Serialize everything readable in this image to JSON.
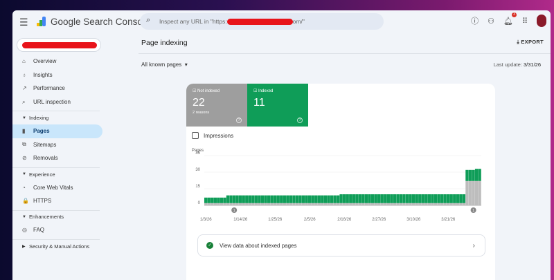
{
  "header": {
    "app_name": "Google Search Console",
    "search_placeholder_prefix": "Inspect any URL in \"https:",
    "search_placeholder_suffix": "om/\"",
    "notification_count": "3",
    "icons": [
      "menu-icon",
      "help-icon",
      "manage-users-icon",
      "bell-icon",
      "apps-grid-icon",
      "avatar"
    ]
  },
  "sidebar": {
    "top": [
      {
        "label": "Overview",
        "icon": "⌂"
      },
      {
        "label": "Insights",
        "icon": "♁"
      },
      {
        "label": "Performance",
        "icon": "↗"
      },
      {
        "label": "URL inspection",
        "icon": "⌕"
      }
    ],
    "indexing": {
      "label": "Indexing",
      "items": [
        {
          "label": "Pages",
          "icon": "▮"
        },
        {
          "label": "Sitemaps",
          "icon": "⧉"
        },
        {
          "label": "Removals",
          "icon": "⊘"
        }
      ]
    },
    "experience": {
      "label": "Experience",
      "items": [
        {
          "label": "Core Web Vitals",
          "icon": "◔"
        },
        {
          "label": "HTTPS",
          "icon": "🔒"
        }
      ]
    },
    "enhancements": {
      "label": "Enhancements",
      "items": [
        {
          "label": "FAQ",
          "icon": "◎"
        }
      ]
    },
    "security": {
      "label": "Security & Manual Actions"
    }
  },
  "main": {
    "title": "Page indexing",
    "export_label": "EXPORT",
    "filter_label": "All known pages",
    "last_update_label": "Last update:",
    "last_update_value": "3/31/26",
    "tiles": {
      "not_indexed": {
        "label": "Not indexed",
        "value": "22",
        "sub": "2 reasons",
        "color": "#9e9e9e"
      },
      "indexed": {
        "label": "Indexed",
        "value": "11",
        "color": "#0f9d58"
      }
    },
    "impressions_label": "Impressions",
    "cta_label": "View data about indexed pages"
  },
  "chart_data": {
    "type": "bar",
    "stacked": true,
    "ylabel": "Pages",
    "ylim": [
      0,
      45
    ],
    "yticks": [
      "0",
      "15",
      "30",
      "45"
    ],
    "xticks": [
      "1/3/26",
      "1/14/26",
      "1/25/26",
      "2/5/26",
      "2/16/26",
      "2/27/26",
      "3/10/26",
      "3/21/26"
    ],
    "annotations": [
      {
        "date": "1/12/26",
        "label": "1"
      },
      {
        "date": "3/29/26",
        "label": "1"
      }
    ],
    "x": [
      "1/3/26",
      "1/4/26",
      "1/5/26",
      "1/6/26",
      "1/7/26",
      "1/8/26",
      "1/9/26",
      "1/10/26",
      "1/11/26",
      "1/12/26",
      "1/13/26",
      "1/14/26",
      "1/15/26",
      "1/16/26",
      "1/17/26",
      "1/18/26",
      "1/19/26",
      "1/20/26",
      "1/21/26",
      "1/22/26",
      "1/23/26",
      "1/24/26",
      "1/25/26",
      "1/26/26",
      "1/27/26",
      "1/28/26",
      "1/29/26",
      "1/30/26",
      "1/31/26",
      "2/1/26",
      "2/2/26",
      "2/3/26",
      "2/4/26",
      "2/5/26",
      "2/6/26",
      "2/7/26",
      "2/8/26",
      "2/9/26",
      "2/10/26",
      "2/11/26",
      "2/12/26",
      "2/13/26",
      "2/14/26",
      "2/15/26",
      "2/16/26",
      "2/17/26",
      "2/18/26",
      "2/19/26",
      "2/20/26",
      "2/21/26",
      "2/22/26",
      "2/23/26",
      "2/24/26",
      "2/25/26",
      "2/26/26",
      "2/27/26",
      "2/28/26",
      "3/1/26",
      "3/2/26",
      "3/3/26",
      "3/4/26",
      "3/5/26",
      "3/6/26",
      "3/7/26",
      "3/8/26",
      "3/9/26",
      "3/10/26",
      "3/11/26",
      "3/12/26",
      "3/13/26",
      "3/14/26",
      "3/15/26",
      "3/16/26",
      "3/17/26",
      "3/18/26",
      "3/19/26",
      "3/20/26",
      "3/21/26",
      "3/22/26",
      "3/23/26",
      "3/24/26",
      "3/25/26",
      "3/26/26",
      "3/27/26",
      "3/28/26",
      "3/29/26",
      "3/30/26",
      "3/31/26"
    ],
    "series": [
      {
        "name": "Not indexed",
        "color": "#bdbdbd",
        "values": [
          2,
          2,
          2,
          2,
          2,
          2,
          2,
          2,
          2,
          2,
          2,
          2,
          2,
          2,
          2,
          2,
          2,
          2,
          2,
          2,
          2,
          2,
          2,
          2,
          2,
          2,
          2,
          2,
          2,
          2,
          2,
          2,
          2,
          2,
          2,
          2,
          2,
          2,
          2,
          2,
          2,
          2,
          2,
          2,
          2,
          2,
          2,
          2,
          2,
          2,
          2,
          2,
          2,
          2,
          2,
          2,
          2,
          2,
          2,
          2,
          2,
          2,
          2,
          2,
          2,
          2,
          2,
          2,
          2,
          2,
          2,
          2,
          2,
          2,
          2,
          2,
          2,
          2,
          2,
          2,
          2,
          2,
          2,
          22,
          22,
          22,
          22,
          22
        ]
      },
      {
        "name": "Indexed",
        "color": "#0f9d58",
        "values": [
          5,
          5,
          5,
          5,
          5,
          5,
          5,
          7,
          7,
          7,
          7,
          7,
          7,
          7,
          7,
          7,
          7,
          7,
          7,
          7,
          7,
          7,
          7,
          7,
          7,
          7,
          7,
          7,
          7,
          7,
          7,
          7,
          7,
          7,
          7,
          7,
          7,
          7,
          7,
          7,
          7,
          7,
          7,
          8,
          8,
          8,
          8,
          8,
          8,
          8,
          8,
          8,
          8,
          8,
          8,
          8,
          8,
          8,
          8,
          8,
          8,
          8,
          8,
          8,
          8,
          8,
          8,
          8,
          8,
          8,
          8,
          8,
          8,
          8,
          8,
          8,
          8,
          8,
          8,
          8,
          8,
          8,
          8,
          10,
          10,
          10,
          11,
          11
        ]
      }
    ]
  }
}
